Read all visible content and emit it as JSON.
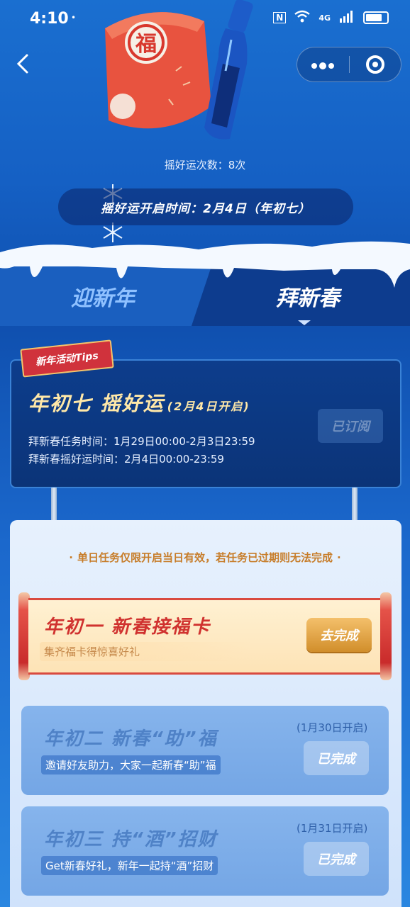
{
  "status_bar": {
    "time": "4:10",
    "dot": "•",
    "network": "4G",
    "nfc": "N"
  },
  "nav": {
    "back_icon": "chevron-left-icon",
    "more_icon": "more-dots-icon",
    "close_icon": "target-icon"
  },
  "hero": {
    "dice_char": "福",
    "shake_count": "摇好运次数：8次",
    "open_time": "摇好运开启时间：2月4日（年初七）"
  },
  "tabs": [
    {
      "label": "迎新年",
      "active": false
    },
    {
      "label": "拜新春",
      "active": true
    }
  ],
  "tips": {
    "ribbon": "新年活动Tips",
    "title": "年初七  摇好运",
    "title_sub": "(2月4日开启)",
    "line1": "拜新春任务时间：1月29日00:00-2月3日23:59",
    "line2": "拜新春摇好运时间：2月4日00:00-23:59",
    "subscribe_label": "已订阅"
  },
  "tasks": {
    "rule": "单日任务仅限开启当日有效，若任务已过期则无法完成",
    "items": [
      {
        "title": "年初一  新春接福卡",
        "desc": "集齐福卡得惊喜好礼",
        "button": "去完成",
        "open_date": ""
      },
      {
        "title": "年初二  新春“助”福",
        "desc": "邀请好友助力，大家一起新春“助”福",
        "button": "已完成",
        "open_date": "(1月30日开启)"
      },
      {
        "title": "年初三  持“酒”招财",
        "desc": "Get新春好礼，新年一起持“酒”招财",
        "button": "已完成",
        "open_date": "(1月31日开启)"
      }
    ]
  },
  "colors": {
    "accent_gold": "#ffe8a8",
    "task_red": "#c92b2b",
    "button_gold": "#d18e2b"
  }
}
